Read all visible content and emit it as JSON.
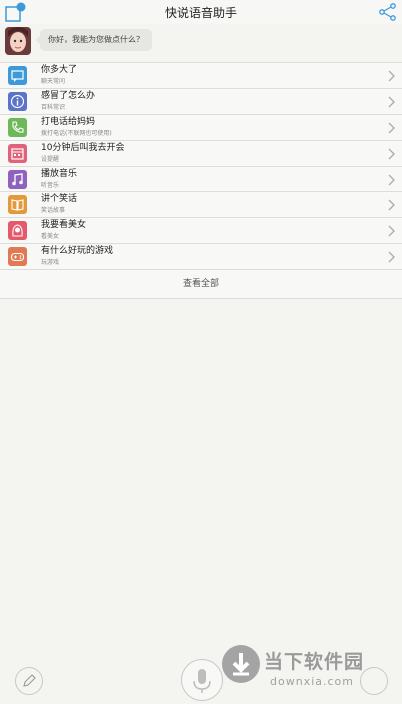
{
  "header": {
    "title": "快说语音助手"
  },
  "greeting": {
    "text": "你好，我能为您做点什么？"
  },
  "commands": [
    {
      "main": "你多大了",
      "sub": "聊天常问",
      "icon": "chat-icon",
      "color": "#3d9ad8"
    },
    {
      "main": "感冒了怎么办",
      "sub": "百科常识",
      "icon": "info-icon",
      "color": "#5b74c9"
    },
    {
      "main": "打电话给妈妈",
      "sub": "拨打电话(不联网也可使用)",
      "icon": "phone-icon",
      "color": "#6fb85a"
    },
    {
      "main": "10分钟后叫我去开会",
      "sub": "设提醒",
      "icon": "calendar-icon",
      "color": "#e0637a"
    },
    {
      "main": "播放音乐",
      "sub": "听音乐",
      "icon": "music-icon",
      "color": "#9062bf"
    },
    {
      "main": "讲个笑话",
      "sub": "笑话故事",
      "icon": "book-icon",
      "color": "#e49a3a"
    },
    {
      "main": "我要看美女",
      "sub": "看美女",
      "icon": "girl-icon",
      "color": "#e55a6a"
    },
    {
      "main": "有什么好玩的游戏",
      "sub": "玩游戏",
      "icon": "gamepad-icon",
      "color": "#e07a55"
    }
  ],
  "view_all": "查看全部",
  "watermark": {
    "brand": "当下软件园",
    "url": "downxia.com"
  }
}
